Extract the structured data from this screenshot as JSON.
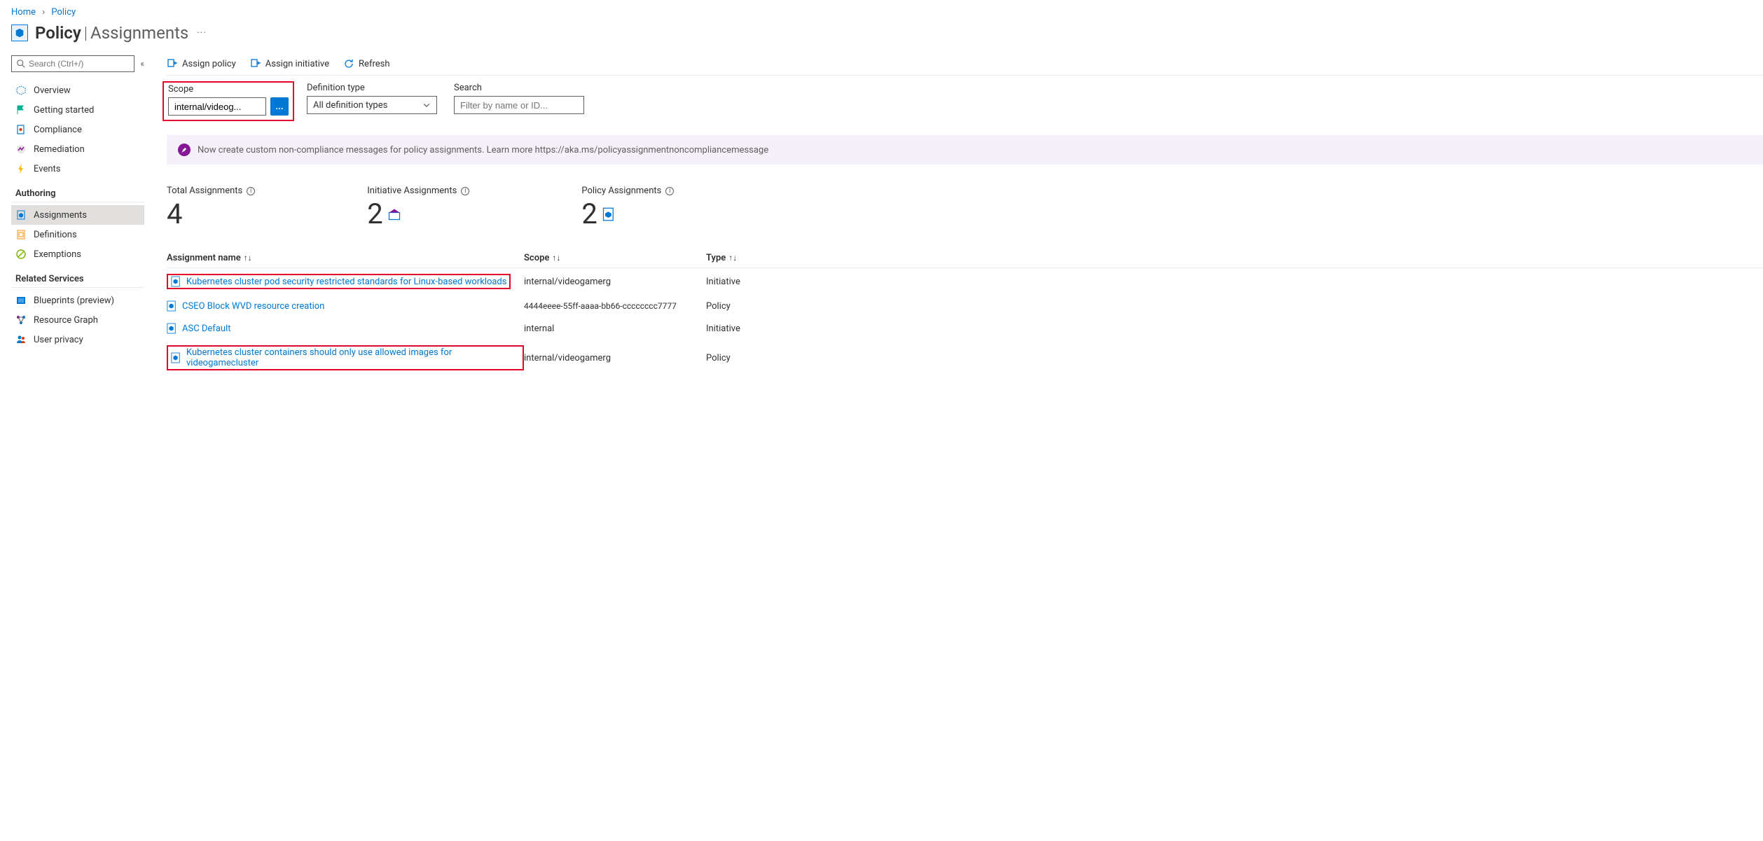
{
  "breadcrumb": {
    "home": "Home",
    "policy": "Policy"
  },
  "header": {
    "title": "Policy",
    "subtitle": "Assignments",
    "more": "···"
  },
  "sidebar": {
    "search_placeholder": "Search (Ctrl+/)",
    "items": [
      {
        "label": "Overview"
      },
      {
        "label": "Getting started"
      },
      {
        "label": "Compliance"
      },
      {
        "label": "Remediation"
      },
      {
        "label": "Events"
      }
    ],
    "section_authoring": "Authoring",
    "authoring_items": [
      {
        "label": "Assignments",
        "active": true
      },
      {
        "label": "Definitions"
      },
      {
        "label": "Exemptions"
      }
    ],
    "section_related": "Related Services",
    "related_items": [
      {
        "label": "Blueprints (preview)"
      },
      {
        "label": "Resource Graph"
      },
      {
        "label": "User privacy"
      }
    ]
  },
  "toolbar": {
    "assign_policy": "Assign policy",
    "assign_initiative": "Assign initiative",
    "refresh": "Refresh"
  },
  "filters": {
    "scope_label": "Scope",
    "scope_value": "internal/videog...",
    "scope_btn": "...",
    "def_type_label": "Definition type",
    "def_type_value": "All definition types",
    "search_label": "Search",
    "search_placeholder": "Filter by name or ID..."
  },
  "banner": {
    "text": "Now create custom non-compliance messages for policy assignments. Learn more https://aka.ms/policyassignmentnoncompliancemessage"
  },
  "stats": {
    "total_label": "Total Assignments",
    "total_value": "4",
    "initiative_label": "Initiative Assignments",
    "initiative_value": "2",
    "policy_label": "Policy Assignments",
    "policy_value": "2"
  },
  "table": {
    "headers": {
      "name": "Assignment name",
      "scope": "Scope",
      "type": "Type"
    },
    "rows": [
      {
        "name": "Kubernetes cluster pod security restricted standards for Linux-based workloads",
        "scope": "internal/videogamerg",
        "type": "Initiative",
        "highlighted": true
      },
      {
        "name": "CSEO Block WVD resource creation",
        "scope": "4444eeee-55ff-aaaa-bb66-cccccccc7777",
        "type": "Policy",
        "highlighted": false,
        "scope_small": true
      },
      {
        "name": "ASC Default",
        "scope": "internal",
        "type": "Initiative",
        "highlighted": false
      },
      {
        "name": "Kubernetes cluster containers should only use allowed images for videogamecluster",
        "scope": "internal/videogamerg",
        "type": "Policy",
        "highlighted": true
      }
    ]
  }
}
